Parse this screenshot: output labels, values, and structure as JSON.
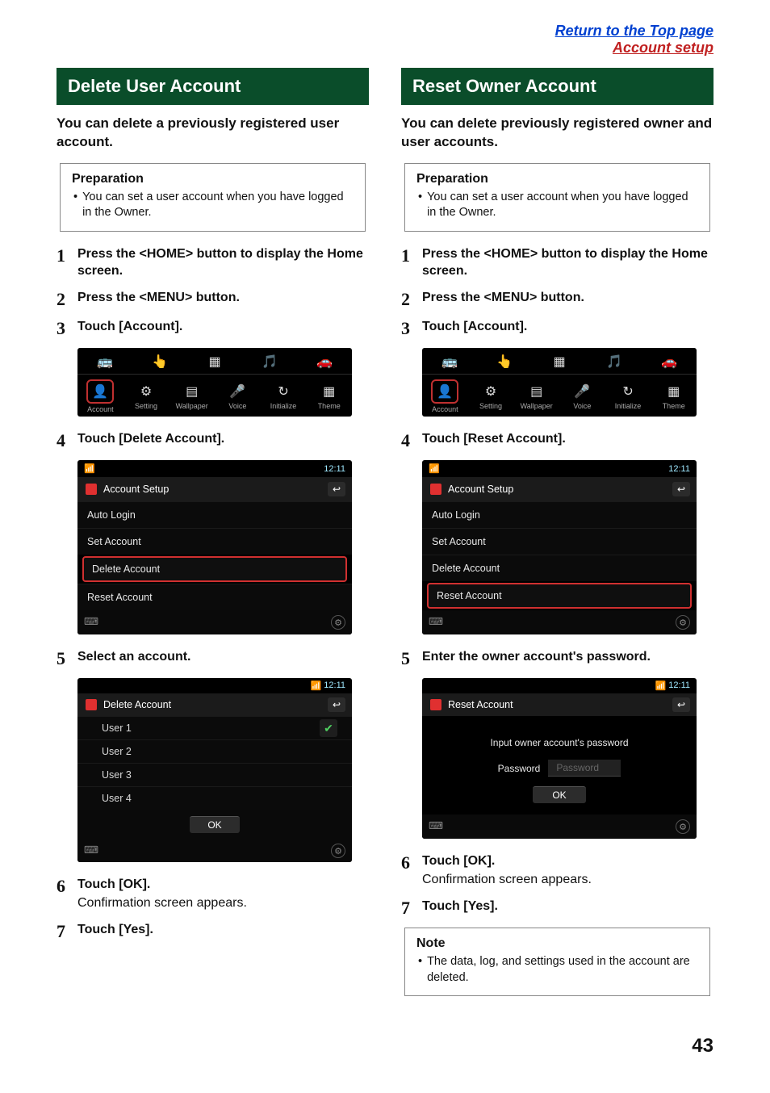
{
  "top_links": {
    "return": "Return to the Top page",
    "section": "Account setup"
  },
  "left": {
    "title": "Delete User Account",
    "lead": "You can delete a previously registered user account.",
    "prep_title": "Preparation",
    "prep_text": "You can set a user account when you have logged in the Owner.",
    "steps": {
      "s1": "Press the <HOME> button to display the Home screen.",
      "s2": "Press the <MENU> button.",
      "s3": "Touch [Account].",
      "s4": "Touch [Delete Account].",
      "s5": "Select an account.",
      "s6": "Touch [OK].",
      "s6_sub": "Confirmation screen appears.",
      "s7": "Touch [Yes]."
    },
    "icon_labels": [
      "Account",
      "Setting",
      "Wallpaper",
      "Voice",
      "Initialize",
      "Theme"
    ],
    "listshot": {
      "clock": "12:11",
      "title": "Account Setup",
      "rows": [
        "Auto Login",
        "Set Account",
        "Delete Account",
        "Reset Account"
      ],
      "highlight_index": 2
    },
    "usershot": {
      "clock": "12:11",
      "title": "Delete Account",
      "users": [
        "User 1",
        "User 2",
        "User 3",
        "User 4"
      ],
      "checked_index": 0,
      "ok": "OK"
    }
  },
  "right": {
    "title": "Reset Owner Account",
    "lead": "You can delete previously registered owner and user accounts.",
    "prep_title": "Preparation",
    "prep_text": "You can set a user account when you have logged in the Owner.",
    "steps": {
      "s1": "Press the <HOME> button to display the Home screen.",
      "s2": "Press the <MENU> button.",
      "s3": "Touch [Account].",
      "s4": "Touch [Reset Account].",
      "s5": "Enter the owner account's password.",
      "s6": "Touch [OK].",
      "s6_sub": "Confirmation screen appears.",
      "s7": "Touch [Yes]."
    },
    "icon_labels": [
      "Account",
      "Setting",
      "Wallpaper",
      "Voice",
      "Initialize",
      "Theme"
    ],
    "listshot": {
      "clock": "12:11",
      "title": "Account Setup",
      "rows": [
        "Auto Login",
        "Set Account",
        "Delete Account",
        "Reset Account"
      ],
      "highlight_index": 3
    },
    "resetshot": {
      "clock": "12:11",
      "title": "Reset Account",
      "prompt": "Input owner account's password",
      "pw_label": "Password",
      "pw_placeholder": "Password",
      "ok": "OK"
    },
    "note_title": "Note",
    "note_text": "The data, log, and settings used in the account are deleted."
  },
  "page_number": "43",
  "icons_glyphs": [
    "👤",
    "⚙",
    "▤",
    "🎤",
    "↻",
    "▦"
  ]
}
